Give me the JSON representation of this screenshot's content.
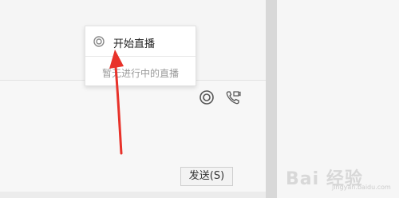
{
  "popup": {
    "title": "开始直播",
    "empty_text": "暂无进行中的直播"
  },
  "toolbar": {
    "live_icon": "live-stream-icon",
    "phone_icon": "video-call-icon"
  },
  "input": {
    "send_label": "发送(S)"
  },
  "watermark": {
    "text": "Bai 经验",
    "url": "jingyan.baidu.com"
  },
  "annotation": {
    "arrow_color": "#e8322a"
  }
}
